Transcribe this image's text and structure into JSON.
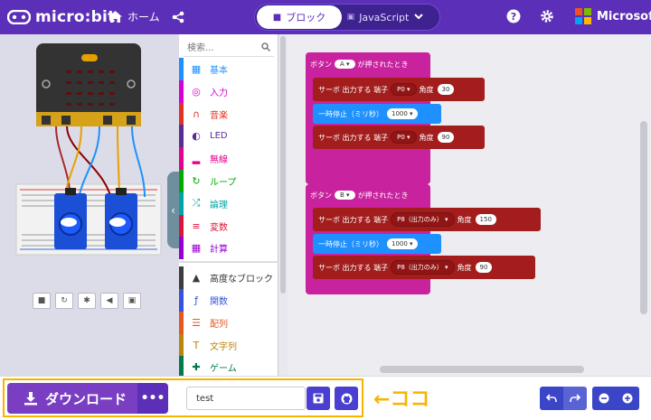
{
  "header": {
    "logo": "micro:bit",
    "home_label": "ホーム",
    "tabs": [
      {
        "label": "ブロック",
        "active": true
      },
      {
        "label": "JavaScript",
        "active": false
      }
    ],
    "brand": "Microsoft"
  },
  "toolbox": {
    "search_placeholder": "検索...",
    "categories": [
      {
        "label": "基本",
        "icon": "grid-icon",
        "color": "#1e90ff"
      },
      {
        "label": "入力",
        "icon": "target-icon",
        "color": "#d400d4"
      },
      {
        "label": "音楽",
        "icon": "headphones-icon",
        "color": "#e63022"
      },
      {
        "label": "LED",
        "icon": "toggle-icon",
        "color": "#5c2d91"
      },
      {
        "label": "無線",
        "icon": "signal-icon",
        "color": "#e3008c"
      },
      {
        "label": "ループ",
        "icon": "refresh-icon",
        "color": "#00aa00"
      },
      {
        "label": "論理",
        "icon": "shuffle-icon",
        "color": "#00a4a6"
      },
      {
        "label": "変数",
        "icon": "list-icon",
        "color": "#dc143c"
      },
      {
        "label": "計算",
        "icon": "calculator-icon",
        "color": "#9400d3"
      },
      {
        "label": "高度なブロック",
        "icon": "chevron-up-icon",
        "color": "#3c3c3c"
      },
      {
        "label": "関数",
        "icon": "function-icon",
        "color": "#3455db"
      },
      {
        "label": "配列",
        "icon": "array-icon",
        "color": "#e65722"
      },
      {
        "label": "文字列",
        "icon": "text-icon",
        "color": "#b8860b"
      },
      {
        "label": "ゲーム",
        "icon": "gamepad-icon",
        "color": "#007a4b"
      }
    ]
  },
  "workspace": {
    "event_a": {
      "prefix": "ボタン",
      "button": "A",
      "suffix": "が押されたとき",
      "servo1": {
        "text": "サーボ 出力する 端子",
        "pin": "P0",
        "angle_label": "角度",
        "angle": "30"
      },
      "pause": {
        "text": "一時停止（ミリ秒）",
        "ms": "1000"
      },
      "servo2": {
        "text": "サーボ 出力する 端子",
        "pin": "P0",
        "angle_label": "角度",
        "angle": "90"
      }
    },
    "event_b": {
      "prefix": "ボタン",
      "button": "B",
      "suffix": "が押されたとき",
      "servo1": {
        "text": "サーボ 出力する 端子",
        "pin": "P8（出力のみ）",
        "angle_label": "角度",
        "angle": "150"
      },
      "pause": {
        "text": "一時停止（ミリ秒）",
        "ms": "1000"
      },
      "servo2": {
        "text": "サーボ 出力する 端子",
        "pin": "P8（出力のみ）",
        "angle_label": "角度",
        "angle": "90"
      }
    }
  },
  "bottom": {
    "download_label": "ダウンロード",
    "more_label": "•••",
    "project_name": "test",
    "annotation": "←ココ"
  },
  "colors": {
    "header": "#5c2fb8",
    "event_block": "#c8229e",
    "servo_block": "#a31d1d",
    "pause_block": "#1e90ff",
    "highlight": "#f7b500"
  }
}
